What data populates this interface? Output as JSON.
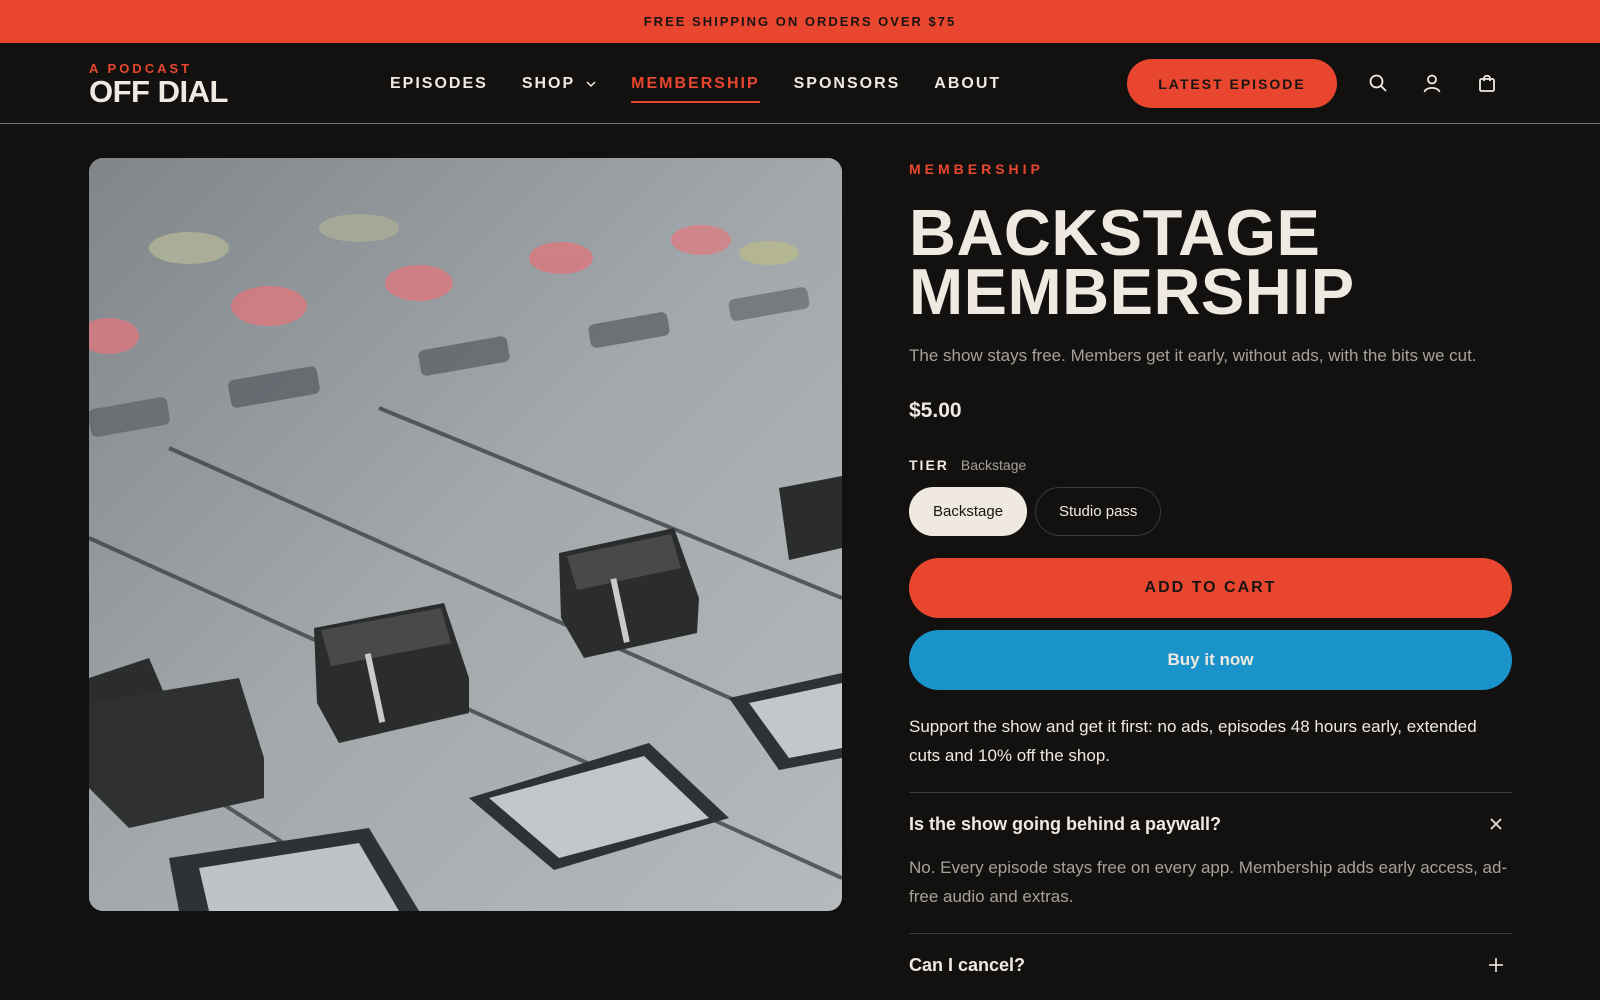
{
  "announcement": "FREE SHIPPING ON ORDERS OVER $75",
  "logo": {
    "kicker": "A PODCAST",
    "name": "OFF DIAL"
  },
  "nav": {
    "items": [
      {
        "label": "EPISODES"
      },
      {
        "label": "SHOP"
      },
      {
        "label": "MEMBERSHIP"
      },
      {
        "label": "SPONSORS"
      },
      {
        "label": "ABOUT"
      }
    ],
    "active": "MEMBERSHIP",
    "cta": "LATEST EPISODE",
    "icons": [
      "search-icon",
      "account-icon",
      "cart-icon"
    ]
  },
  "product": {
    "image_alt": "mixing-console-faders",
    "eyebrow": "MEMBERSHIP",
    "title_line1": "BACKSTAGE",
    "title_line2": "MEMBERSHIP",
    "subtitle": "The show stays free. Members get it early, without ads, with the bits we cut.",
    "price": "$5.00",
    "tier_label": "TIER",
    "tier_value": "Backstage",
    "tiers": [
      "Backstage",
      "Studio pass"
    ],
    "selected_tier": "Backstage",
    "add_to_cart": "ADD TO CART",
    "buy_now": "Buy it now",
    "description": "Support the show and get it first: no ads, episodes 48 hours early, extended cuts and 10% off the shop."
  },
  "faq": [
    {
      "question": "Is the show going behind a paywall?",
      "answer": "No. Every episode stays free on every app. Membership adds early access, ad-free audio and extras.",
      "open": true
    },
    {
      "question": "Can I cancel?",
      "open": false
    }
  ],
  "colors": {
    "accent": "#e8462e",
    "background": "#121110",
    "text": "#efe9e1",
    "muted": "#a6a19b",
    "buy_button": "#1a92ca"
  }
}
